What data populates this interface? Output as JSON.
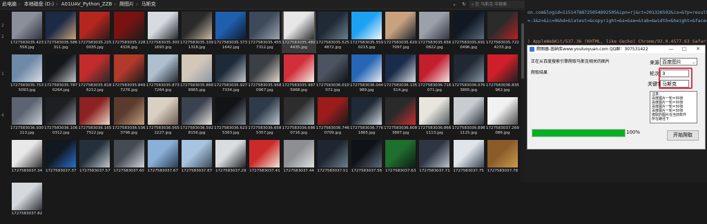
{
  "explorer": {
    "breadcrumb": [
      "此电脑",
      "本地磁盘 (D:)",
      "A01UAV_Python_ZZB",
      "爬图片",
      "马斯克"
    ],
    "search_placeholder": "在 马斯克 中搜索",
    "row_rail_digits": [
      "2",
      "2",
      "1",
      "4"
    ],
    "files": [
      {
        "name": "1727583035.423558.jpg",
        "colors": [
          "#8a8f99",
          "#2d3540"
        ]
      },
      {
        "name": "1727583035.586311.jpg",
        "colors": [
          "#1b2a45",
          "#c9a27c"
        ]
      },
      {
        "name": "1727583035.2250035.jpg",
        "colors": [
          "#b5261f",
          "#2d1a16"
        ]
      },
      {
        "name": "1727583035.2284326.jpg",
        "colors": [
          "#7a1212",
          "#1c1c1c"
        ]
      },
      {
        "name": "1727583035.3031693.jpg",
        "colors": [
          "#d7dbe0",
          "#22272e"
        ]
      },
      {
        "name": "1727583035.3391318.jpg",
        "colors": [
          "#2a2a2a",
          "#c9b8a5"
        ]
      },
      {
        "name": "1727583035.3731642.jpg",
        "colors": [
          "#1f5fae",
          "#0d1b30"
        ]
      },
      {
        "name": "1727583035.4557312.jpg",
        "colors": [
          "#3d4a5a",
          "#9aa5b1"
        ]
      },
      {
        "name": "1727583035.4894435.jpg",
        "colors": [
          "#e7e7e7",
          "#2e2e2e"
        ]
      },
      {
        "name": "1727583035.5254872.jpg",
        "colors": [
          "#202a36",
          "#6e7f90"
        ]
      },
      {
        "name": "1727583035.5590215.jpg",
        "colors": [
          "#1da1f2",
          "#f5f8fa"
        ]
      },
      {
        "name": "1727583035.6207097.jpg",
        "colors": [
          "#c8a27e",
          "#1e2430"
        ]
      },
      {
        "name": "1727583035.6560822.jpg",
        "colors": [
          "#9aa1aa",
          "#303640"
        ]
      },
      {
        "name": "1727583035.6910496.jpg",
        "colors": [
          "#0f1823",
          "#5a6a7c"
        ]
      },
      {
        "name": "1727583035.7224233.jpg",
        "colors": [
          "#2b2b2b",
          "#b82222"
        ]
      },
      {
        "name": "1727583035.7535093.jpg",
        "colors": [
          "#6f8aa8",
          "#d9dde2"
        ]
      },
      {
        "name": "1727583035.7870264.jpg",
        "colors": [
          "#14161a",
          "#c0c4c9"
        ]
      },
      {
        "name": "1727583035.8186212.jpg",
        "colors": [
          "#c22c2c",
          "#2a2a2a"
        ]
      },
      {
        "name": "1727583035.8497276.jpg",
        "colors": [
          "#b33a2a",
          "#1a1a1a"
        ]
      },
      {
        "name": "1727583035.8737264.jpg",
        "colors": [
          "#aebfcf",
          "#232a33"
        ]
      },
      {
        "name": "1727583035.8988965.jpg",
        "colors": [
          "#d4c7b8",
          "#8d99a6"
        ]
      },
      {
        "name": "1727583035.9277334.jpg",
        "colors": [
          "#1e2a3a",
          "#c5c9cf"
        ]
      },
      {
        "name": "1727583035.9580967.jpg",
        "colors": [
          "#3b3f46",
          "#e3d8cb"
        ]
      },
      {
        "name": "1727583035.9875968.jpg",
        "colors": [
          "#d22f3a",
          "#f2efe9"
        ]
      },
      {
        "name": "1727583036.010072.jpg",
        "colors": [
          "#4b5562",
          "#101418"
        ]
      },
      {
        "name": "1727583036.044989.jpg",
        "colors": [
          "#2766b5",
          "#e9edf2"
        ]
      },
      {
        "name": "1727583036.135514.jpg",
        "colors": [
          "#1b2b4a",
          "#d8dde3"
        ]
      },
      {
        "name": "1727583036.716071.jpg",
        "colors": [
          "#c31e2e",
          "#f0e3e3"
        ]
      },
      {
        "name": "1727583036.0763865.jpg",
        "colors": [
          "#202833",
          "#8895a3"
        ]
      },
      {
        "name": "1727583036.835962.jpg",
        "colors": [
          "#d01f2a",
          "#1e1e1e"
        ]
      },
      {
        "name": "1727583036.930113.jpg",
        "colors": [
          "#5b6470",
          "#c9ced4"
        ]
      },
      {
        "name": "1727583036.1060312.jpg",
        "colors": [
          "#1d1f23",
          "#9aa0a8"
        ]
      },
      {
        "name": "1727583036.1657522.jpg",
        "colors": [
          "#8c2222",
          "#e9d8c4"
        ]
      },
      {
        "name": "1727583036.5363796.jpg",
        "colors": [
          "#5a3b2e",
          "#c4a07e"
        ]
      },
      {
        "name": "1727583036.5652227.jpg",
        "colors": [
          "#d9cfc2",
          "#6b5a4a"
        ]
      },
      {
        "name": "1727583036.5928156.jpg",
        "colors": [
          "#3a4250",
          "#e6e1da"
        ]
      },
      {
        "name": "1727583036.6235363.jpg",
        "colors": [
          "#111317",
          "#7b8590"
        ]
      },
      {
        "name": "1727583036.6585357.jpg",
        "colors": [
          "#2f3b4a",
          "#bfc7cf"
        ]
      },
      {
        "name": "1727583036.6860716.jpg",
        "colors": [
          "#2d2d2d",
          "#a8afb7"
        ]
      },
      {
        "name": "1727583036.7460709.jpg",
        "colors": [
          "#9c1c1c",
          "#1a1a1a"
        ]
      },
      {
        "name": "1727583036.7761865.jpg",
        "colors": [
          "#1f2a36",
          "#d1d5da"
        ]
      },
      {
        "name": "1727583036.8083887.jpg",
        "colors": [
          "#2a2a2a",
          "#c92d2d"
        ]
      },
      {
        "name": "1727583036.8661113.jpg",
        "colors": [
          "#e9e5de",
          "#50585f"
        ]
      },
      {
        "name": "1727583036.8981125.jpg",
        "colors": [
          "#c8ccd0",
          "#2b3138"
        ]
      },
      {
        "name": "1727583037.269086.jpg",
        "colors": [
          "#f1f1f1",
          "#4a4a4a"
        ]
      },
      {
        "name": "1727583037.34",
        "colors": [
          "#e8e8e8",
          "#333333"
        ]
      },
      {
        "name": "1727583037.37",
        "colors": [
          "#101820",
          "#2a6fd0"
        ]
      },
      {
        "name": "1727583037.57",
        "colors": [
          "#24303c",
          "#c0c6cd"
        ]
      },
      {
        "name": "1727583037.60",
        "colors": [
          "#444b53",
          "#ced3d8"
        ]
      },
      {
        "name": "1727583037.67",
        "colors": [
          "#8ab0d8",
          "#2b3d52"
        ]
      },
      {
        "name": "1727583037.67",
        "colors": [
          "#a8c4e0",
          "#3c4a58"
        ]
      },
      {
        "name": "1727583037.29",
        "colors": [
          "#dadde0",
          "#202428"
        ]
      },
      {
        "name": "1727583037.41",
        "colors": [
          "#cc2a2a",
          "#efe6d9"
        ]
      },
      {
        "name": "1727583037.44",
        "colors": [
          "#8d8f92",
          "#e0e0e0"
        ]
      },
      {
        "name": "1727583037.51",
        "colors": [
          "#1e2731",
          "#70808f"
        ]
      },
      {
        "name": "1727583037.56",
        "colors": [
          "#0f1218",
          "#5d6b79"
        ]
      },
      {
        "name": "1727583037.63",
        "colors": [
          "#1f6f2f",
          "#0e1a10"
        ]
      },
      {
        "name": "1727583037.71",
        "colors": [
          "#2d3642",
          "#b9c1ca"
        ]
      },
      {
        "name": "1727583037.75",
        "colors": [
          "#dfe5ea",
          "#3a4653"
        ]
      },
      {
        "name": "1727583037.78",
        "colors": [
          "#8b5c2a",
          "#c99a4d"
        ]
      },
      {
        "name": "1727583037.82",
        "colors": [
          "#d5d8dc",
          "#2c3238"
        ]
      }
    ]
  },
  "code": {
    "lines": [
      "on.com&logid=11514788725054892505&ipn=rj&ct=201326592&is=&fp=result&",
      "=-1&z=&ic=0&hd=&latest=&copyright=&s=&se=&tab=&width=&height=&face=",
      "",
      "",
      ") AppleWebKit/537.36 (KHTML, like Gecko) Chrome/92.0.4577.63 Safari"
    ]
  },
  "dialog": {
    "title": "爬图器-崮纳库www.youluoyuan.com QQ群：307531422",
    "status": "正在从百度搜索引擎爬取马斯克相关的图片",
    "result_label": "爬取结果",
    "source_label": "来源",
    "source_value": "百度图片",
    "rounds_label": "轮次",
    "rounds_value": "3",
    "keyword_label": "关键字",
    "keyword_value": "马斯克",
    "notes": [
      "注意:",
      "百度图片一轮=30张",
      "百度图片一轮=30张",
      "百度图片一轮=30张",
      "百度图片一轮=30张",
      "爬取的图片在当前软件",
      "所在路径下"
    ],
    "progress_value": 1.0,
    "progress_text": "100%",
    "start_button": "开始爬取",
    "minimize": "—",
    "maximize": "□",
    "close": "✕"
  }
}
